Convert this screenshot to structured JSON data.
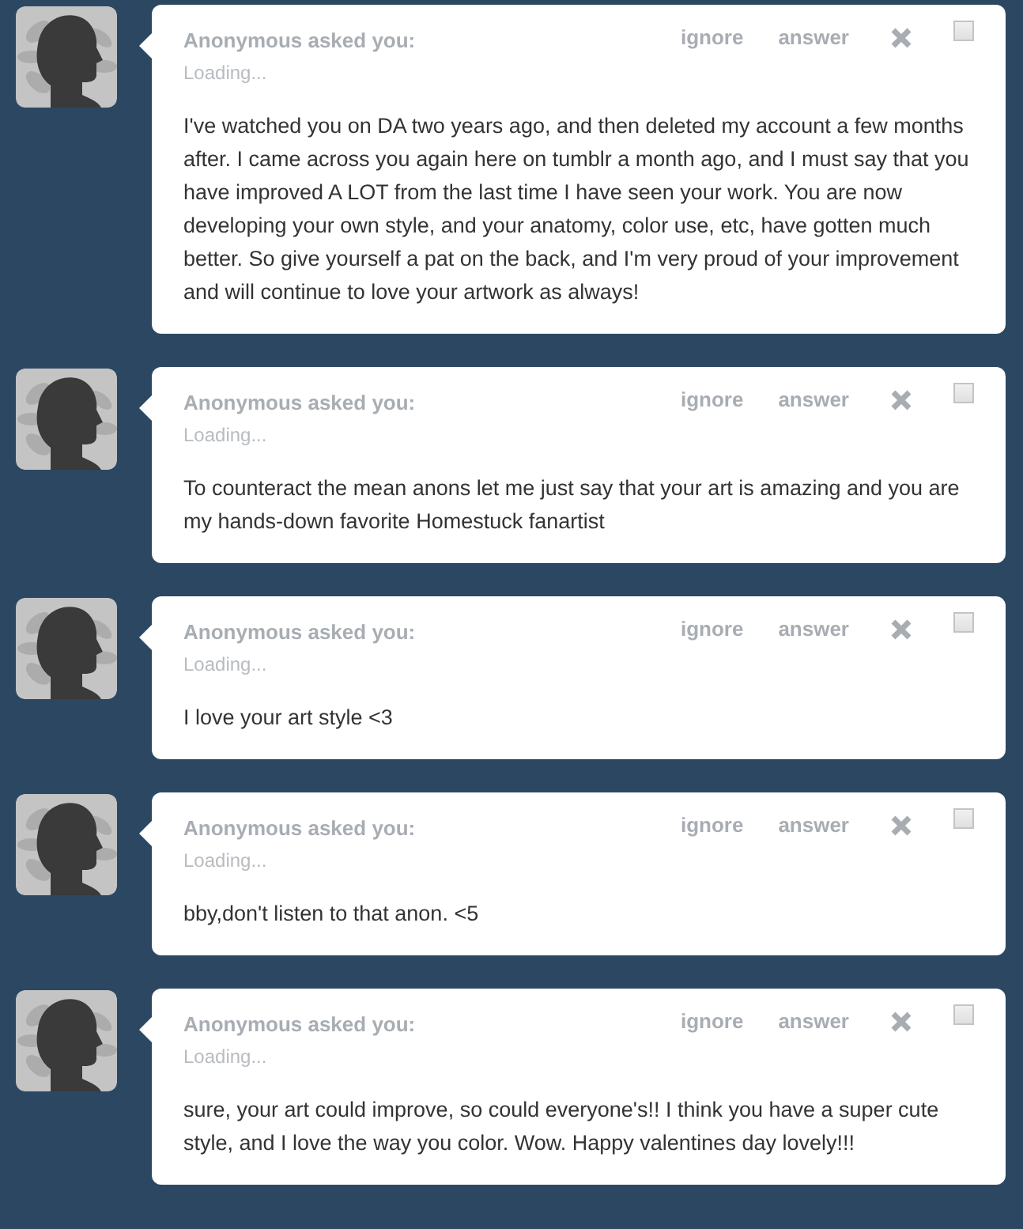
{
  "posts": [
    {
      "asker": "Anonymous asked you:",
      "status": "Loading...",
      "actions": [
        "ignore",
        "answer"
      ],
      "checked": false,
      "question": "I've watched you on DA two years ago, and then deleted my account a few months after. I came across you again here on tumblr a month ago, and I must say that you have improved A LOT from the last time I have seen your work. You are now developing your own style, and your anatomy, color use, etc, have gotten much better. So give yourself a pat on the back, and I'm very proud of your improvement and will continue to love your artwork as always!"
    },
    {
      "asker": "Anonymous asked you:",
      "status": "Loading...",
      "actions": [
        "ignore",
        "answer"
      ],
      "checked": false,
      "question": "To counteract the mean anons let me just say that your art is amazing and you are my hands-down favorite Homestuck fanartist"
    },
    {
      "asker": "Anonymous asked you:",
      "status": "Loading...",
      "actions": [
        "ignore",
        "answer"
      ],
      "checked": false,
      "question": "I love your art style <3"
    },
    {
      "asker": "Anonymous asked you:",
      "status": "Loading...",
      "actions": [
        "ignore",
        "answer"
      ],
      "checked": false,
      "question": "bby,don't listen to that anon. <5"
    },
    {
      "asker": "Anonymous asked you:",
      "status": "Loading...",
      "actions": [
        "ignore",
        "answer"
      ],
      "checked": false,
      "question": "sure, your art could improve, so could everyone's!! I think you have a super cute style, and I love the way you color. Wow. Happy valentines day lovely!!!"
    }
  ]
}
